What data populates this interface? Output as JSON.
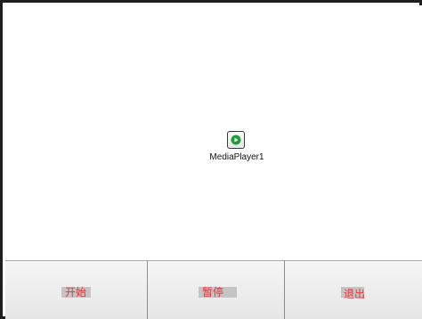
{
  "media_player": {
    "label": "MediaPlayer1",
    "icon": "play-icon",
    "accent_color": "#1f9c3c"
  },
  "buttons": {
    "start_label": "开始",
    "pause_label": "暂停",
    "exit_label": "退出",
    "label_color": "#e0353c"
  }
}
